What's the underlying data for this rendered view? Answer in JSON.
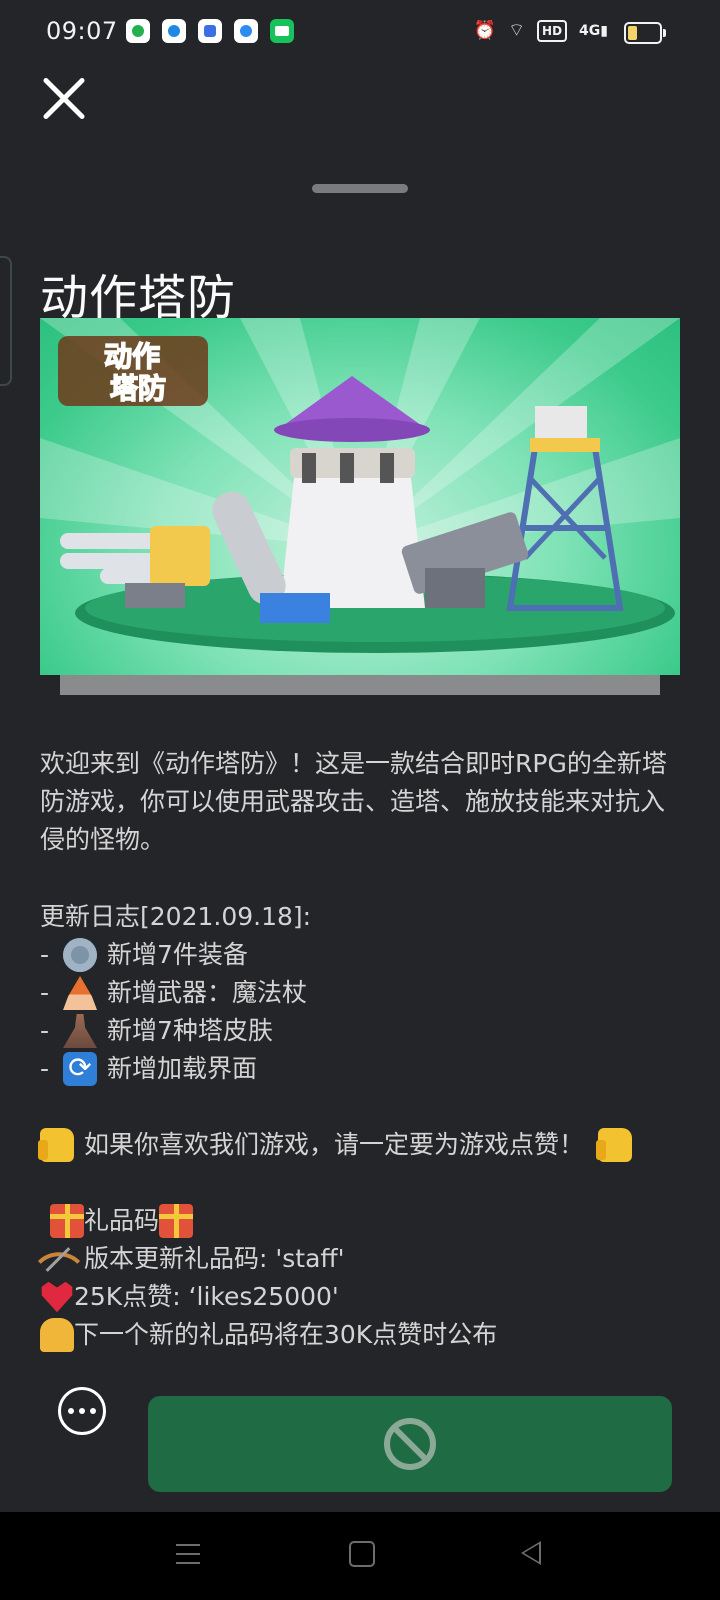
{
  "status_bar": {
    "time": "09:07",
    "app_icons": [
      "video-app-icon",
      "browser-app-icon",
      "baidu-app-icon",
      "cloud-app-icon",
      "iqiyi-app-icon"
    ],
    "hd_label": "HD",
    "network_label": "4G",
    "battery_level": 0.3
  },
  "game": {
    "title": "动作塔防",
    "banner_logo_alt": "动作 塔防"
  },
  "description": "欢迎来到《动作塔防》！这是一款结合即时RPG的全新塔防游戏，你可以使用武器攻击、造塔、施放技能来对抗入侵的怪物。",
  "changelog": {
    "header": "更新日志[2021.09.18]:",
    "items": [
      {
        "icon": "gear-icon",
        "text": "新增7件装备"
      },
      {
        "icon": "mage-icon",
        "text": "新增武器：魔法杖"
      },
      {
        "icon": "tower-icon",
        "text": "新增7种塔皮肤"
      },
      {
        "icon": "refresh-icon",
        "text": "新增加载界面"
      }
    ]
  },
  "like_prompt": "如果你喜欢我们游戏，请一定要为游戏点赞！",
  "gift": {
    "header": "礼品码",
    "version_code": "版本更新礼品码: 'staff'",
    "likes_code": "25K点赞: ‘likes25000'",
    "next_code": "下一个新的礼品码将在30K点赞时公布"
  },
  "colors": {
    "background": "#242528",
    "play_button": "#1f6b43",
    "banner_green": "#3bca8a"
  }
}
